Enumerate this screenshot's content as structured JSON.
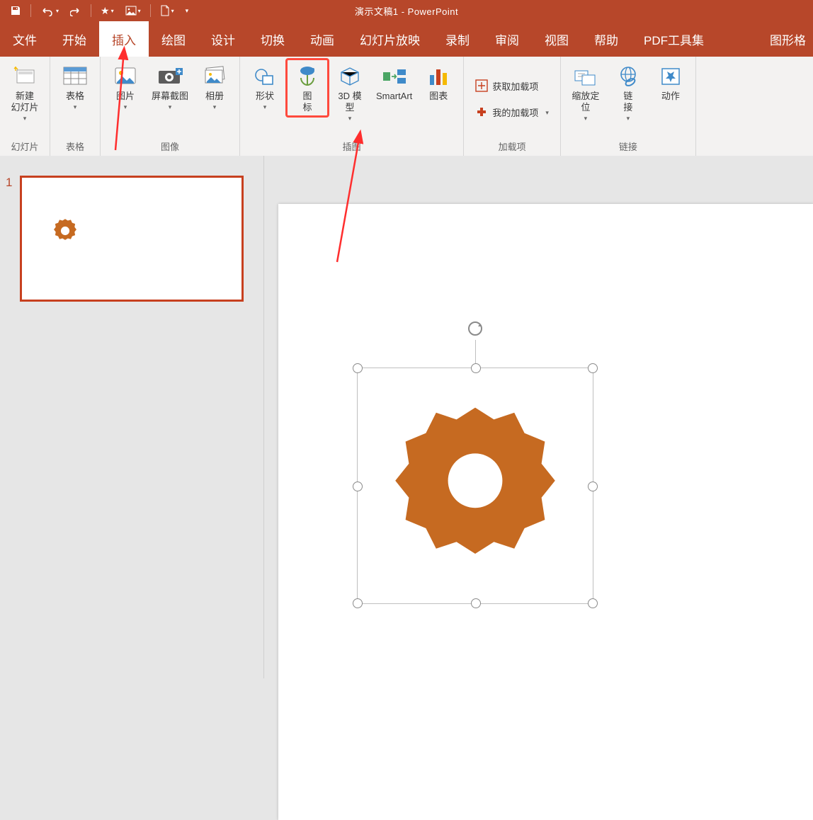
{
  "title": "演示文稿1 - PowerPoint",
  "context_tab": "图形格",
  "tabs": [
    "文件",
    "开始",
    "插入",
    "绘图",
    "设计",
    "切换",
    "动画",
    "幻灯片放映",
    "录制",
    "审阅",
    "视图",
    "帮助",
    "PDF工具集"
  ],
  "active_tab_index": 2,
  "qat": {
    "save": "save-icon",
    "undo": "undo-icon",
    "redo": "redo-icon",
    "start": "start-from-beginning-icon"
  },
  "ribbon": {
    "groups": [
      {
        "label": "幻灯片",
        "buttons": [
          {
            "name": "new-slide",
            "text": "新建\n幻灯片",
            "caret": true
          }
        ]
      },
      {
        "label": "表格",
        "buttons": [
          {
            "name": "table",
            "text": "表格",
            "caret": true
          }
        ]
      },
      {
        "label": "图像",
        "buttons": [
          {
            "name": "pictures",
            "text": "图片",
            "caret": true
          },
          {
            "name": "screenshot",
            "text": "屏幕截图",
            "caret": true
          },
          {
            "name": "photo-album",
            "text": "相册",
            "caret": true
          }
        ]
      },
      {
        "label": "插图",
        "buttons": [
          {
            "name": "shapes",
            "text": "形状",
            "caret": true
          },
          {
            "name": "icons",
            "text": "图\n标",
            "hi": true
          },
          {
            "name": "3d-models",
            "text": "3D 模\n型",
            "caret": true
          },
          {
            "name": "smartart",
            "text": "SmartArt"
          },
          {
            "name": "chart",
            "text": "图表"
          }
        ]
      },
      {
        "label": "加载项",
        "rows": [
          {
            "name": "get-addins",
            "text": "获取加载项"
          },
          {
            "name": "my-addins",
            "text": "我的加载项",
            "caret": true
          }
        ]
      },
      {
        "label": "链接",
        "buttons": [
          {
            "name": "zoom",
            "text": "缩放定\n位",
            "caret": true
          },
          {
            "name": "link",
            "text": "链\n接",
            "caret": true
          },
          {
            "name": "action",
            "text": "动作"
          }
        ]
      }
    ]
  },
  "thumb": {
    "number": "1"
  },
  "colors": {
    "brand": "#b7472a",
    "gear": "#c66a21",
    "arrow": "#ff2e2e"
  }
}
